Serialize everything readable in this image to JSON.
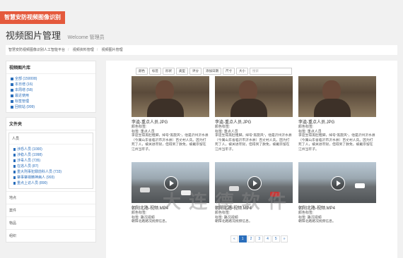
{
  "brand": "智慧安防视频图像识别",
  "page": {
    "title": "视频图片管理",
    "subtitle": "Welcome 管理员"
  },
  "breadcrumb": [
    "智慧安防视频图像识别人工智能平台",
    "视频资料管理",
    "视频图片管理"
  ],
  "library": {
    "title": "视频图片库",
    "items": [
      "全部 (150008)",
      "本日增 (16)",
      "本周增 (58)",
      "最近使用",
      "标签管理",
      "回收站 (999)"
    ]
  },
  "folder": {
    "title": "文件夹",
    "group": "人员",
    "items": [
      "涉恐人员 (1000)",
      "涉稳人员 (1998)",
      "涉毒人员 (735)",
      "在逃人员 (87)",
      "重大刑事犯罪前科人员 (733)",
      "肇事肇祸精神病人 (993)",
      "重点上访人员 (890)"
    ],
    "others": [
      "地点",
      "案件",
      "物品",
      "组织"
    ]
  },
  "toolbar": [
    "颜色",
    "标签",
    "形状",
    "类型",
    "评分",
    "添加日期",
    "尺寸",
    "大小"
  ],
  "search_placeholder": "搜索",
  "cards": [
    {
      "title": "李逵-重点人员.JPG",
      "l1": "颜色标签:",
      "l2": "标签: 重点人员",
      "desc": "李逵生得黑肚粗脚，绰号“黑旋风”，他是沂州沂水县（今属山东省临沂市沂水县）百丈村人氏。因为打死了人，被关进牢狱，但得到了赦免，被戴宗留在江州当牢子。"
    },
    {
      "title": "李逵-重点人员.JPG",
      "l1": "颜色标签:",
      "l2": "标签: 重点人员",
      "desc": "李逵生得黑肚粗脚，绰号“黑旋风”，他是沂州沂水县（今属山东省临沂市沂水县）百丈村人氏。因为打死了人，被关进牢狱，但得到了赦免，被戴宗留在江州当牢子。"
    },
    {
      "title": "李逵-重点人员.JPG",
      "l1": "颜色标签:",
      "l2": "标签: 重点人员",
      "desc": "李逵生得黑肚粗脚，绰号“黑旋风”，他是沂州沂水县（今属山东省临沂市沂水县）百丈村人氏。因为打死了人，被关进牢狱，但得到了赦免，被戴宗留在江州当牢子。"
    },
    {
      "title": "朝阳北路-视频.MP4",
      "l1": "颜色标签:",
      "l2": "标签: 路况视频",
      "desc": "朝阳北路路况视频信息。"
    },
    {
      "title": "朝阳北路-视频.MP4",
      "l1": "颜色标签:",
      "l2": "标签: 路况视频",
      "desc": "朝阳北路路况视频信息。"
    },
    {
      "title": "朝阳北路-视频.MP4",
      "l1": "颜色标签:",
      "l2": "标签: 路况视频",
      "desc": "朝阳北路路况视频信息。"
    }
  ],
  "pager": [
    "«",
    "1",
    "2",
    "3",
    "4",
    "5",
    "»"
  ],
  "watermark": "大 连 德 软 件"
}
